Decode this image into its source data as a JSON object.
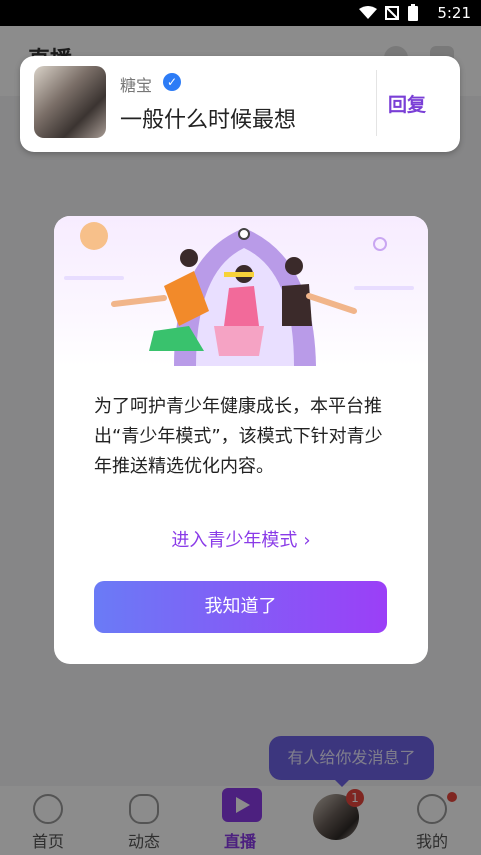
{
  "status_bar": {
    "time": "5:21"
  },
  "header": {
    "title": "直播"
  },
  "notification": {
    "sender": "糖宝",
    "message": "一般什么时候最想",
    "reply_label": "回复"
  },
  "modal": {
    "body_text": "为了呵护青少年健康成长，本平台推出“青少年模式”，该模式下针对青少年推送精选优化内容。",
    "link_label": "进入青少年模式",
    "button_label": "我知道了"
  },
  "toast": {
    "text": "有人给你发消息了"
  },
  "bottom_nav": [
    {
      "label": "首页",
      "icon": "home-heart-icon"
    },
    {
      "label": "动态",
      "icon": "star-icon"
    },
    {
      "label": "直播",
      "icon": "live-video-icon",
      "active": true
    },
    {
      "label": "",
      "icon": "avatar",
      "badge": "1"
    },
    {
      "label": "我的",
      "icon": "profile-icon",
      "dot": true
    }
  ],
  "colors": {
    "accent": "#8a3be8",
    "button_start": "#6a7bf6",
    "button_end": "#9b3ff7",
    "badge": "#e8453c"
  }
}
